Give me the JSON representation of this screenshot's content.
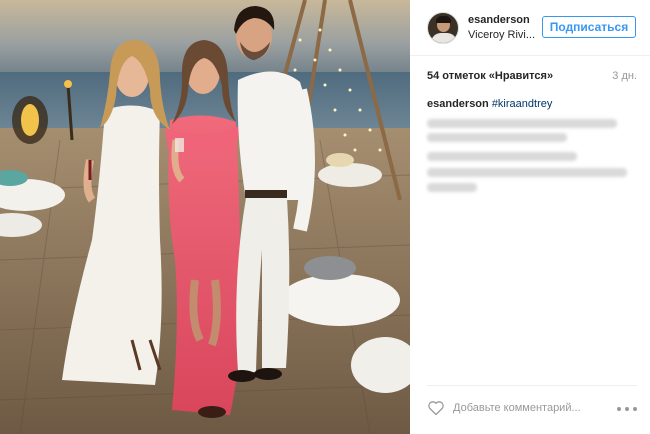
{
  "post": {
    "header": {
      "username": "esanderson",
      "location": "Viceroy Rivi...",
      "follow_label": "Подписаться"
    },
    "stats": {
      "likes": "54 отметок «Нравится»",
      "time_ago": "3 дн."
    },
    "caption": {
      "username": "esanderson",
      "hashtag": "#kiraandtrey"
    },
    "footer": {
      "comment_placeholder": "Добавьте комментарий..."
    },
    "icons": [
      "avatar",
      "heart-icon",
      "more-options-icon"
    ],
    "colors": {
      "accent_blue": "#3897f0",
      "hashtag": "#003569",
      "muted": "#999999",
      "dress_coral": "#e8556a"
    }
  }
}
